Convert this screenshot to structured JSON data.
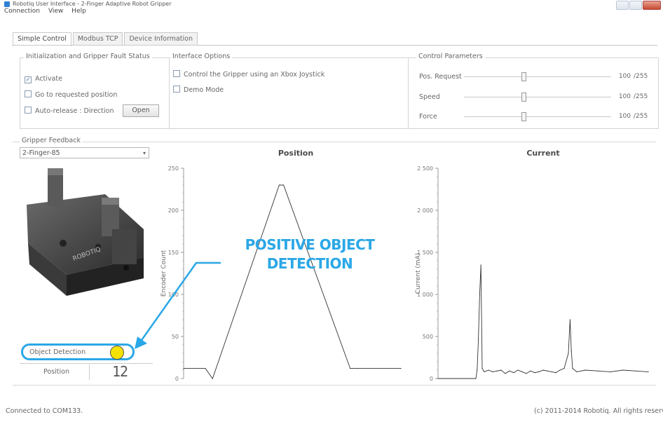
{
  "window": {
    "title": "Robotiq User Interface - 2-Finger Adaptive Robot Gripper",
    "menu": [
      "Connection",
      "View",
      "Help"
    ]
  },
  "tabs": [
    {
      "label": "Simple Control",
      "active": true
    },
    {
      "label": "Modbus TCP",
      "active": false
    },
    {
      "label": "Device Information",
      "active": false
    }
  ],
  "init_group": {
    "title": "Initialization and Gripper Fault Status",
    "activate_label": "Activate",
    "activate_checked": true,
    "goto_label": "Go to requested position",
    "autorelease_label": "Auto-release : Direction",
    "direction_button": "Open"
  },
  "interface_group": {
    "title": "Interface Options",
    "xbox_label": "Control the Gripper using an Xbox Joystick",
    "demo_label": "Demo Mode"
  },
  "control_group": {
    "title": "Control Parameters",
    "params": [
      {
        "label": "Pos. Request",
        "value": "100",
        "max": "/255",
        "fraction": 0.39
      },
      {
        "label": "Speed",
        "value": "100",
        "max": "/255",
        "fraction": 0.39
      },
      {
        "label": "Force",
        "value": "100",
        "max": "/255",
        "fraction": 0.39
      }
    ]
  },
  "feedback": {
    "title": "Gripper Feedback",
    "model_select": "2-Finger-85",
    "object_detection_label": "Object Detection",
    "object_detection_color": "#f5e200",
    "position_label": "Position",
    "position_value": "12"
  },
  "annotation": {
    "line1": "POSITIVE OBJECT",
    "line2": "DETECTION",
    "color": "#2aa7e6"
  },
  "status": {
    "connection": "Connected to COM133.",
    "copyright": "(c) 2011-2014 Robotiq. All rights reserved"
  },
  "chart_data": [
    {
      "type": "line",
      "title": "Position",
      "ylabel": "Encoder Count",
      "xlabel": "",
      "ylim": [
        0,
        250
      ],
      "yticks": [
        "0",
        "50",
        "100",
        "150",
        "200",
        "250"
      ],
      "series": [
        {
          "x": [
            0,
            15,
            20,
            66,
            69,
            115,
            120,
            150
          ],
          "y": [
            12,
            12,
            0,
            230,
            230,
            12,
            12,
            12
          ]
        }
      ],
      "xlim": [
        0,
        150
      ]
    },
    {
      "type": "line",
      "title": "Current",
      "ylabel": "Current (mA)",
      "xlabel": "",
      "ylim": [
        0,
        2500
      ],
      "yticks": [
        "0",
        "500",
        "1 000",
        "1 500",
        "2 000",
        "2 500"
      ],
      "series": [
        {
          "x": [
            0,
            9,
            9.3,
            9.6,
            9.9,
            10.2,
            10.5,
            11,
            12,
            13,
            14,
            15,
            16,
            17,
            18,
            19,
            20,
            21,
            22,
            23,
            24,
            25,
            26,
            27,
            28,
            29,
            30,
            31,
            31.4,
            31.7,
            32,
            33,
            35,
            38,
            41,
            44,
            47,
            50
          ],
          "y": [
            0,
            0,
            100,
            470,
            1000,
            1350,
            120,
            80,
            100,
            80,
            90,
            100,
            60,
            90,
            70,
            100,
            80,
            60,
            90,
            70,
            80,
            100,
            90,
            80,
            70,
            100,
            120,
            300,
            700,
            330,
            120,
            80,
            100,
            90,
            80,
            100,
            90,
            80
          ]
        }
      ],
      "xlim": [
        0,
        50
      ]
    }
  ]
}
